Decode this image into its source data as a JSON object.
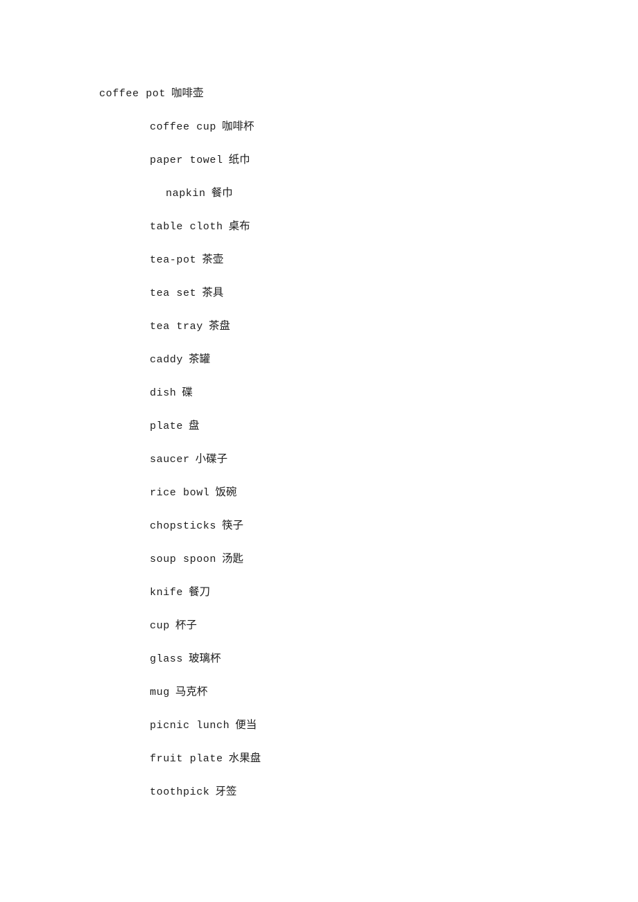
{
  "document": {
    "background_color": "#ffffff",
    "text_color": "#1c1c1c",
    "entries": [
      {
        "term": "coffee pot",
        "gloss": "咖啡壶",
        "indent": 0
      },
      {
        "term": "coffee cup",
        "gloss": "咖啡杯",
        "indent": 1
      },
      {
        "term": "paper towel",
        "gloss": "纸巾",
        "indent": 1
      },
      {
        "term": "napkin",
        "gloss": "餐巾",
        "indent": 2
      },
      {
        "term": "table cloth",
        "gloss": "桌布",
        "indent": 1
      },
      {
        "term": "tea-pot",
        "gloss": "茶壶",
        "indent": 1
      },
      {
        "term": "tea set",
        "gloss": "茶具",
        "indent": 1
      },
      {
        "term": "tea tray",
        "gloss": "茶盘",
        "indent": 1
      },
      {
        "term": "caddy",
        "gloss": "茶罐",
        "indent": 1
      },
      {
        "term": "dish",
        "gloss": "碟",
        "indent": 1
      },
      {
        "term": "plate",
        "gloss": "盘",
        "indent": 1
      },
      {
        "term": "saucer",
        "gloss": "小碟子",
        "indent": 1
      },
      {
        "term": "rice bowl",
        "gloss": "饭碗",
        "indent": 1
      },
      {
        "term": "chopsticks",
        "gloss": "筷子",
        "indent": 1
      },
      {
        "term": "soup spoon",
        "gloss": "汤匙",
        "indent": 1
      },
      {
        "term": "knife",
        "gloss": "餐刀",
        "indent": 1
      },
      {
        "term": "cup",
        "gloss": "杯子",
        "indent": 1
      },
      {
        "term": "glass",
        "gloss": "玻璃杯",
        "indent": 1
      },
      {
        "term": "mug",
        "gloss": "马克杯",
        "indent": 1
      },
      {
        "term": "picnic lunch",
        "gloss": "便当",
        "indent": 1
      },
      {
        "term": "fruit plate",
        "gloss": "水果盘",
        "indent": 1
      },
      {
        "term": "toothpick",
        "gloss": "牙签",
        "indent": 1
      }
    ]
  }
}
